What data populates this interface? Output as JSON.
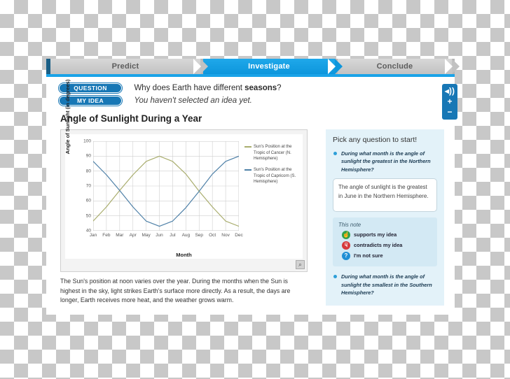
{
  "tabs": [
    {
      "label": "Predict",
      "active": false
    },
    {
      "label": "Investigate",
      "active": true
    },
    {
      "label": "Conclude",
      "active": false
    }
  ],
  "prompt": {
    "question_badge": "QUESTION",
    "question_text_pre": "Why does Earth have different ",
    "question_text_bold": "seasons",
    "question_text_post": "?",
    "idea_badge": "MY IDEA",
    "idea_text": "You haven't selected an idea yet."
  },
  "controls": {
    "speaker": "◂))",
    "zoom_in": "+",
    "zoom_out": "−"
  },
  "section": {
    "title": "Angle of Sunlight During a Year",
    "zoom_icon": "⌕",
    "caption": "The Sun's position at noon varies over the year. During the months when the Sun is highest in the sky, light strikes Earth's surface more directly. As a result, the days are longer, Earth receives more heat, and the weather grows warm."
  },
  "chart_data": {
    "type": "line",
    "title": "Angle of Sunlight During a Year",
    "xlabel": "Month",
    "ylabel": "Angle of Sunlight (in degrees)",
    "categories": [
      "Jan",
      "Feb",
      "Mar",
      "Apr",
      "May",
      "Jun",
      "Jul",
      "Aug",
      "Sep",
      "Oct",
      "Nov",
      "Dec"
    ],
    "ylim": [
      40,
      100
    ],
    "yticks": [
      40,
      50,
      60,
      70,
      80,
      90,
      100
    ],
    "grid": true,
    "legend_position": "right",
    "series": [
      {
        "name": "Sun's Position at the Tropic of Cancer (N. Hemisphere)",
        "color": "#a9ad6e",
        "values": [
          46.5,
          56,
          67,
          77.5,
          86.5,
          90,
          86.5,
          78,
          66.5,
          56,
          46.5,
          43
        ]
      },
      {
        "name": "Sun's Position at the Tropic of Capricorn (S. Hemisphere)",
        "color": "#4f81a8",
        "values": [
          86.5,
          77.5,
          67,
          56,
          46.5,
          43,
          46.5,
          55.5,
          66.5,
          78,
          86.5,
          90
        ]
      }
    ]
  },
  "sidebar": {
    "heading": "Pick any question to start!",
    "question_1": "During what month is the angle of sunlight the greatest in the Northern Hemisphere?",
    "answer_text": "The angle of sunlight is the greatest in June in the Northern Hemisphere.",
    "note_label": "This note",
    "options": [
      {
        "icon": "☝",
        "label": "supports my idea"
      },
      {
        "icon": "☟",
        "label": "contradicts my idea"
      },
      {
        "icon": "?",
        "label": "I'm not sure"
      }
    ],
    "question_2": "During what month is the angle of sunlight the smallest in the Southern Hemisphere?"
  }
}
